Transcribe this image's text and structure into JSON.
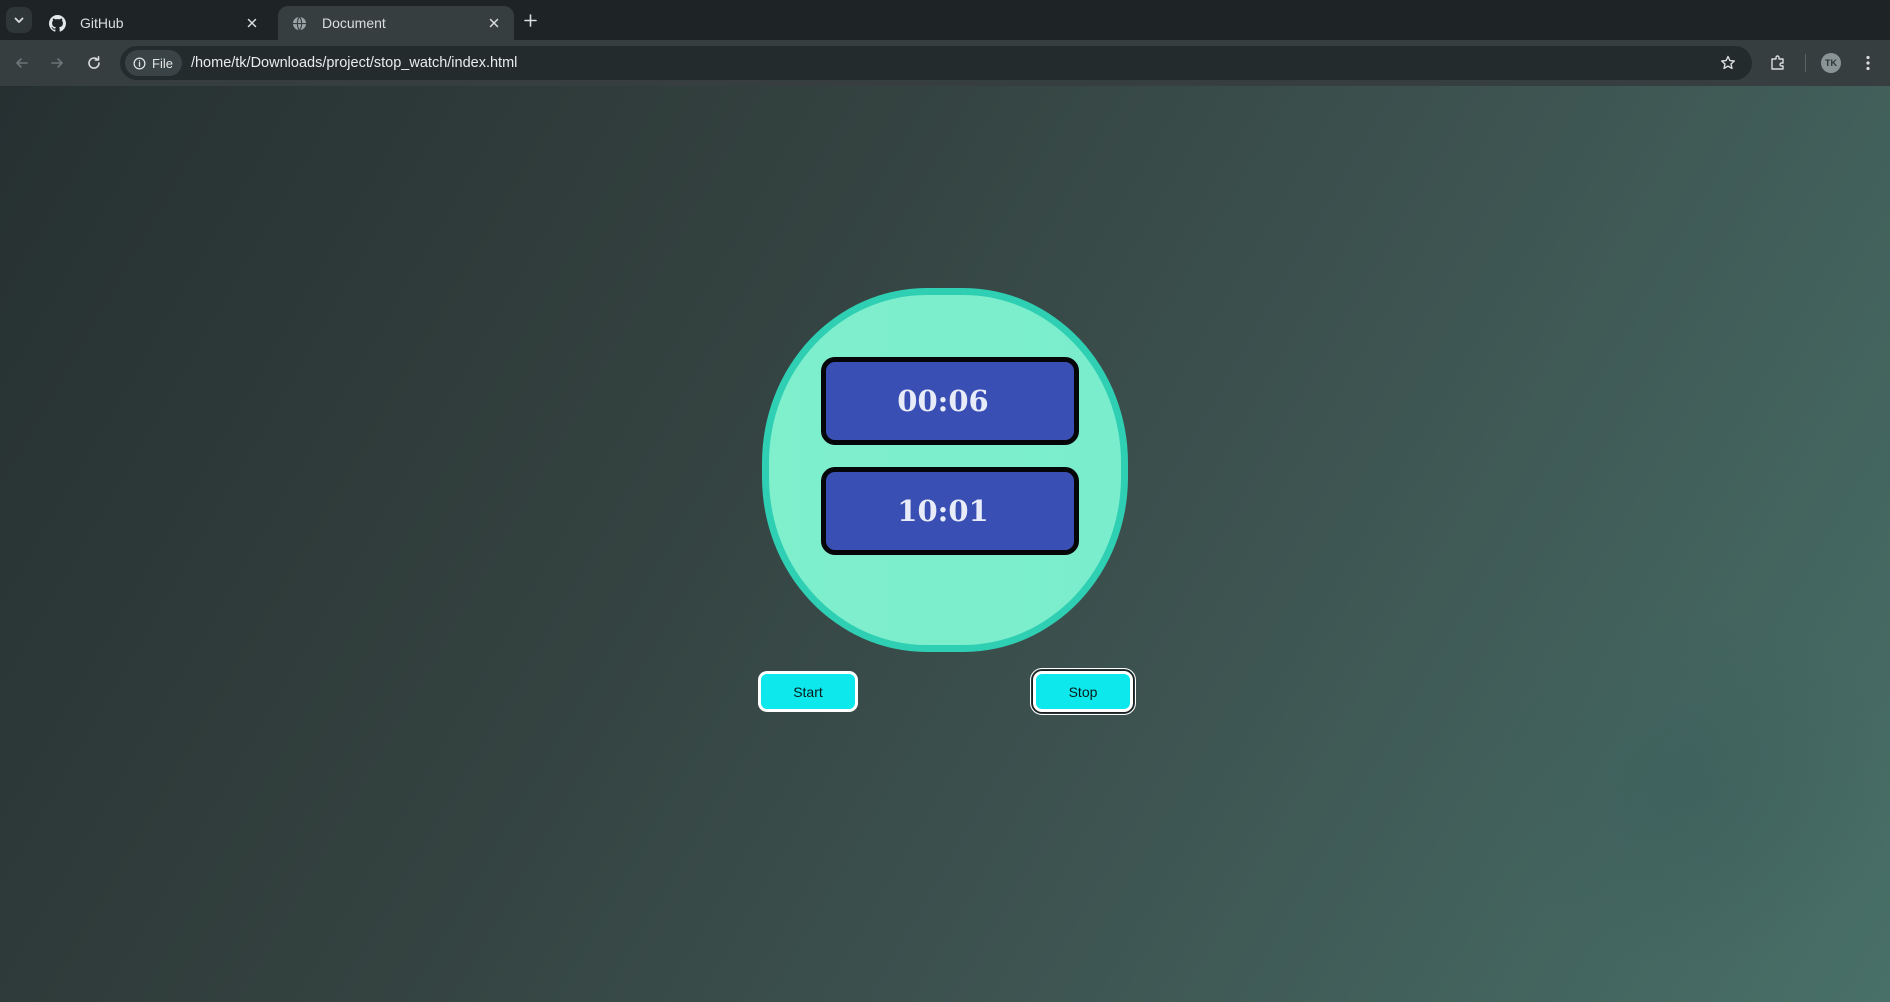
{
  "browser": {
    "tabs": [
      {
        "title": "GitHub",
        "icon": "github-icon",
        "active": false
      },
      {
        "title": "Document",
        "icon": "globe-icon",
        "active": true
      }
    ],
    "omnibox": {
      "chip_label": "File",
      "url": "/home/tk/Downloads/project/stop_watch/index.html"
    },
    "profile_initials": "TK"
  },
  "page": {
    "display_top": "00:06",
    "display_bottom": "10:01",
    "start_label": "Start",
    "stop_label": "Stop"
  },
  "colors": {
    "watch_face": "#7aedcc",
    "watch_border": "#2fcfb4",
    "display_bg": "#3a4fb4",
    "button_bg": "#0ce8ec"
  }
}
